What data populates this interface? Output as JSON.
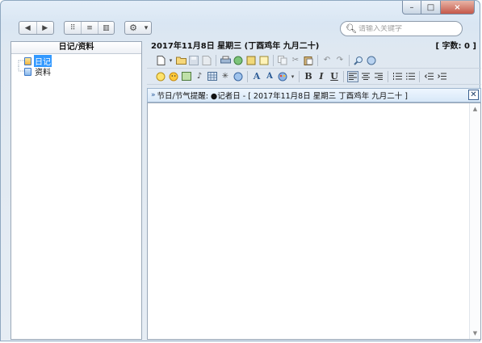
{
  "window": {
    "caption_buttons": {
      "minimize": "–",
      "maximize": "□",
      "close": "×"
    }
  },
  "toolbar": {
    "nav_back": "◀",
    "nav_forward": "▶",
    "view_icons": "⠿",
    "view_list": "≡",
    "view_columns": "▥",
    "settings": "⚙",
    "settings_dropdown": "▾"
  },
  "search": {
    "placeholder": "请输入关键字",
    "icon": "search-icon"
  },
  "left_panel": {
    "header": "日记/资料",
    "tree": [
      {
        "label": "日记",
        "icon": "diary-icon",
        "selected": true
      },
      {
        "label": "资料",
        "icon": "notes-icon",
        "selected": false
      }
    ]
  },
  "editor_info": {
    "date_line": "2017年11月8日 星期三 (丁酉鸡年 九月二十)",
    "word_count": "[ 字数: 0 ]"
  },
  "reminder": {
    "text": "节日/节气提醒: ●记者日 - [ 2017年11月8日 星期三 丁酉鸡年 九月二十 ]"
  },
  "format": {
    "bold": "B",
    "italic": "I",
    "underline": "U",
    "font": "A",
    "font_size": "A"
  },
  "colors": {
    "selection": "#3399ff",
    "window_bg": "#dfe8f1",
    "close_button": "#c4584a"
  }
}
